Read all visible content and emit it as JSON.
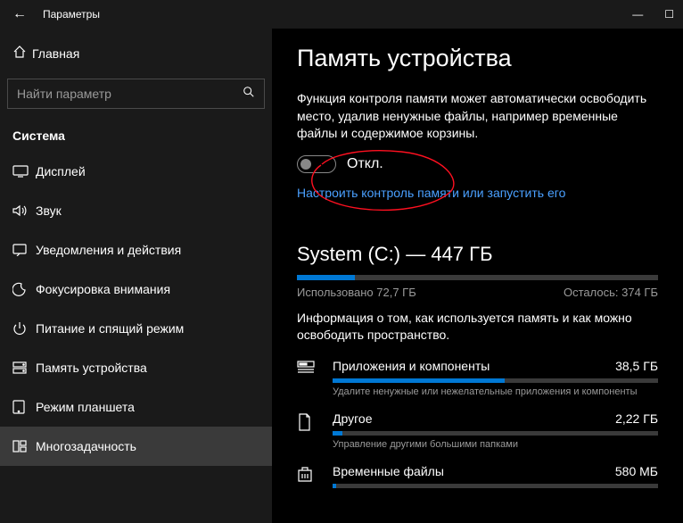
{
  "titlebar": {
    "title": "Параметры"
  },
  "sidebar": {
    "home_label": "Главная",
    "search_placeholder": "Найти параметр",
    "section_label": "Система",
    "items": [
      {
        "label": "Дисплей",
        "icon": "display-icon"
      },
      {
        "label": "Звук",
        "icon": "sound-icon"
      },
      {
        "label": "Уведомления и действия",
        "icon": "notifications-icon"
      },
      {
        "label": "Фокусировка внимания",
        "icon": "focus-icon"
      },
      {
        "label": "Питание и спящий режим",
        "icon": "power-icon"
      },
      {
        "label": "Память устройства",
        "icon": "storage-icon"
      },
      {
        "label": "Режим планшета",
        "icon": "tablet-icon"
      },
      {
        "label": "Многозадачность",
        "icon": "multitask-icon"
      }
    ]
  },
  "main": {
    "heading": "Память устройства",
    "description": "Функция контроля памяти может автоматически освободить место, удалив ненужные файлы, например временные файлы и содержимое корзины.",
    "toggle_state": "Откл.",
    "configure_link": "Настроить контроль памяти или запустить его",
    "drive": {
      "title": "System (C:) — 447 ГБ",
      "used_label": "Использовано 72,7 ГБ",
      "free_label": "Осталось: 374 ГБ",
      "desc": "Информация о том, как используется память и как можно освободить пространство.",
      "categories": [
        {
          "name": "Приложения и компоненты",
          "size": "38,5 ГБ",
          "sub": "Удалите ненужные или нежелательные приложения и компоненты",
          "pct": 53
        },
        {
          "name": "Другое",
          "size": "2,22 ГБ",
          "sub": "Управление другими большими папками",
          "pct": 3
        },
        {
          "name": "Временные файлы",
          "size": "580 МБ",
          "sub": "",
          "pct": 1
        }
      ]
    }
  }
}
